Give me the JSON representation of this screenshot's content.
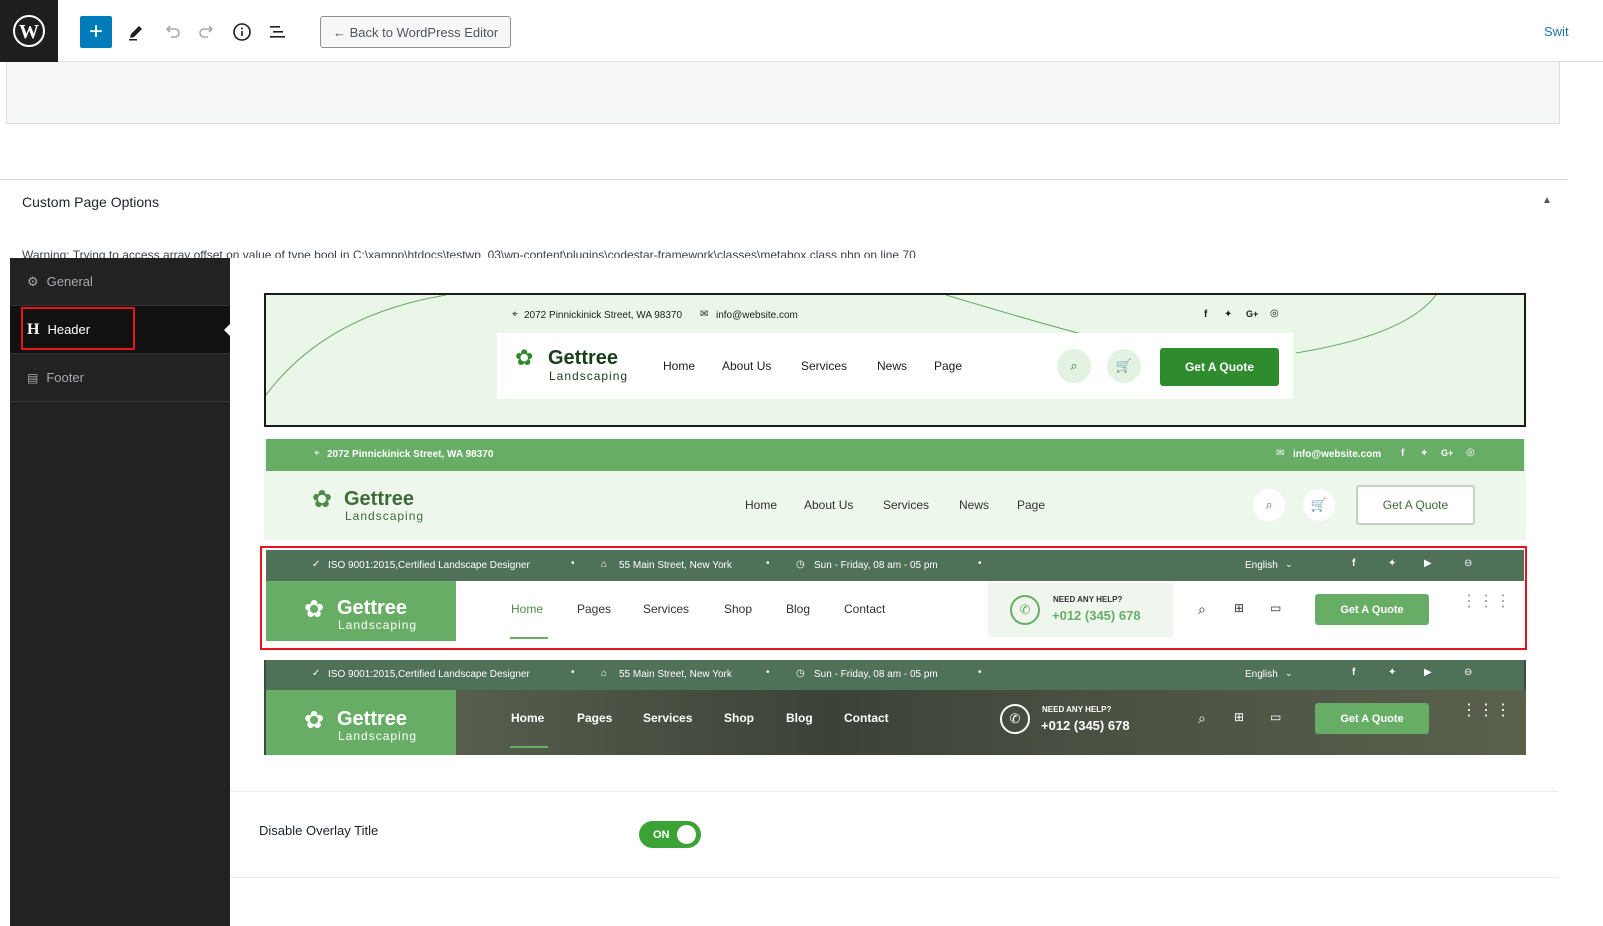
{
  "toolbar": {
    "back_label": "← Back to WordPress Editor",
    "switch_label": "Swit"
  },
  "panel": {
    "title": "Custom Page Options",
    "warning": "Warning: Trying to access array offset on value of type bool in C:\\xampp\\htdocs\\testwp_03\\wp-content\\plugins\\codestar-framework\\classes\\metabox.class.php on line 70"
  },
  "sidebar": {
    "items": [
      {
        "label": "General",
        "icon": "gears-icon"
      },
      {
        "label": "Header",
        "icon": "heading-icon"
      },
      {
        "label": "Footer",
        "icon": "footer-icon"
      }
    ]
  },
  "header1": {
    "address": "2072 Pinnickinick Street, WA 98370",
    "email": "info@website.com",
    "logo": "Gettree",
    "logo_sub": "Landscaping",
    "nav": [
      "Home",
      "About Us",
      "Services",
      "News",
      "Page"
    ],
    "cta": "Get A Quote"
  },
  "header2": {
    "address": "2072 Pinnickinick Street, WA 98370",
    "email": "info@website.com",
    "logo": "Gettree",
    "logo_sub": "Landscaping",
    "nav": [
      "Home",
      "About Us",
      "Services",
      "News",
      "Page"
    ],
    "cta": "Get A Quote"
  },
  "header3": {
    "cert": "ISO 9001:2015,Certified Landscape Designer",
    "street": "55 Main Street, New York",
    "hours": "Sun - Friday, 08 am - 05 pm",
    "lang": "English",
    "logo": "Gettree",
    "logo_sub": "Landscaping",
    "nav": [
      "Home",
      "Pages",
      "Services",
      "Shop",
      "Blog",
      "Contact"
    ],
    "help": "NEED ANY HELP?",
    "phone": "+012 (345) 678",
    "cta": "Get A Quote"
  },
  "header4": {
    "cert": "ISO 9001:2015,Certified Landscape Designer",
    "street": "55 Main Street, New York",
    "hours": "Sun - Friday, 08 am - 05 pm",
    "lang": "English",
    "logo": "Gettree",
    "logo_sub": "Landscaping",
    "nav": [
      "Home",
      "Pages",
      "Services",
      "Shop",
      "Blog",
      "Contact"
    ],
    "help": "NEED ANY HELP?",
    "phone": "+012 (345) 678",
    "cta": "Get A Quote"
  },
  "overlay": {
    "label": "Disable Overlay Title",
    "toggle": "ON"
  },
  "colors": {
    "accent": "#007cba",
    "green": "#2e8b2e",
    "green_light": "#68ad66",
    "green_dark": "#4f7157",
    "highlight": "#e8131d"
  }
}
